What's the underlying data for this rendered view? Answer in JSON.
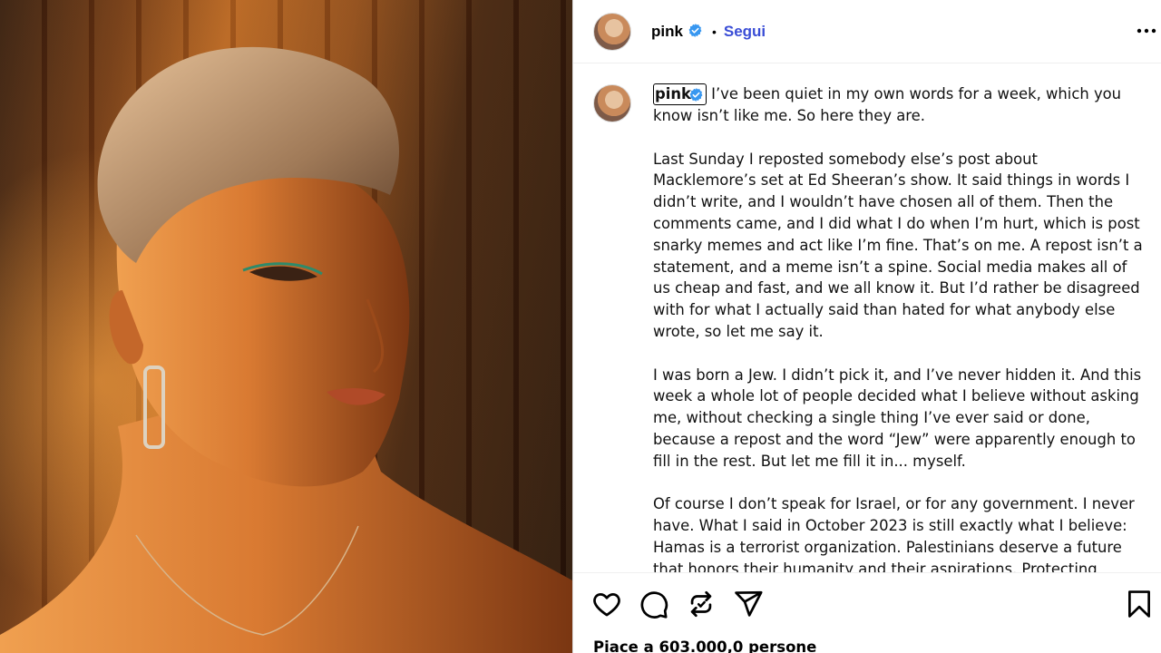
{
  "post": {
    "username": "pink",
    "separator": "•",
    "follow_label": "Segui",
    "verified_icon": "verified-badge-icon",
    "more_icon": "more-options-icon"
  },
  "caption": {
    "username": "pink",
    "paragraphs": [
      "I’ve been quiet in my own words for a week, which you know isn’t like me. So here they are.",
      "Last Sunday I reposted somebody else’s post about Macklemore’s set at Ed Sheeran’s show. It said things in words I didn’t write, and I wouldn’t have chosen all of them. Then the comments came, and I did what I do when I’m hurt, which is post snarky memes and act like I’m fine. That’s on me. A repost isn’t a statement, and a meme isn’t a spine. Social media makes all of us cheap and fast, and we all know it. But I’d rather be disagreed with for what I actually said than hated for what anybody else wrote, so let me say it.",
      "I was born a Jew. I didn’t pick it, and I’ve never hidden it. And this week a whole lot of people decided what I believe without asking me, without checking a single thing I’ve ever said or done, because a repost and the word “Jew” were apparently enough to fill in the rest. But let me fill it in... myself.",
      "Of course I don’t speak for Israel, or for any government. I never have. What I said in October 2023 is still exactly what I believe: Hamas is a terrorist organization. Palestinians deserve a future that honors their humanity and their aspirations. Protecting"
    ]
  },
  "actions": {
    "like_icon": "heart-icon",
    "comment_icon": "comment-icon",
    "repost_icon": "repost-icon",
    "share_icon": "share-icon",
    "save_icon": "bookmark-icon"
  },
  "likes_text": "Piace a 603.000,0 persone",
  "colors": {
    "follow": "#3a4dd6",
    "verified": "#3897f0",
    "border": "#dbdbdb"
  }
}
